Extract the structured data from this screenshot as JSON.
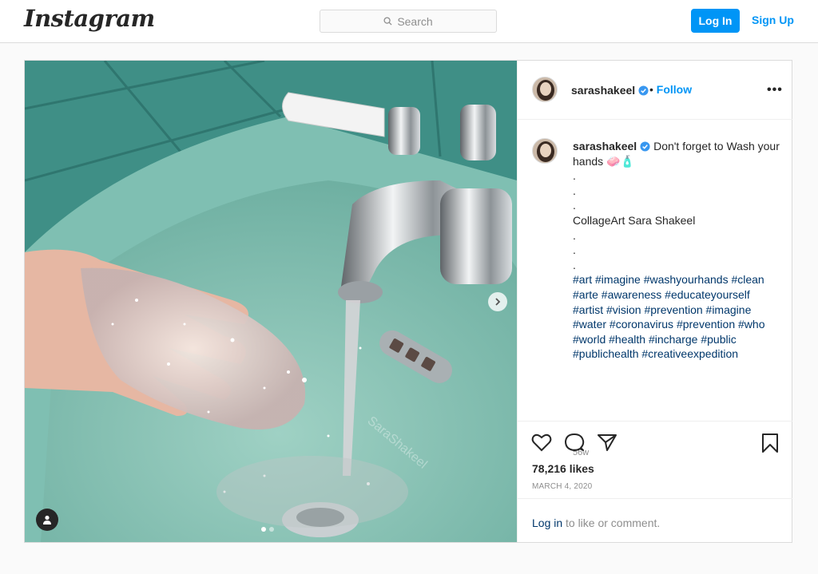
{
  "header": {
    "logo": "Instagram",
    "search_placeholder": "Search",
    "login_label": "Log In",
    "signup_label": "Sign Up"
  },
  "photo": {
    "watermark": "SaraShakeel",
    "carousel_dots": 2,
    "active_dot": 1
  },
  "post": {
    "username": "sarashakeel",
    "follow_label": "Follow",
    "follow_sep": "•",
    "more_label": "•••",
    "caption_first": "Don't forget to Wash your hands 🧼🧴",
    "caption_lines": [
      ".",
      ".",
      ".",
      "CollageArt Sara Shakeel",
      ".",
      ".",
      "."
    ],
    "hashtags": "#art #imagine #washyourhands #clean #arte #awareness #educateyourself #artist #vision #prevention #imagine #water #coronavirus #prevention #who #world #health #incharge #public #publichealth #creativeexpedition",
    "time_ago": "56w",
    "likes": "78,216 likes",
    "date": "MARCH 4, 2020",
    "login_link": "Log in",
    "login_rest": "to like or comment."
  },
  "icons": [
    "search-icon",
    "verified-icon",
    "heart-icon",
    "comment-icon",
    "share-icon",
    "bookmark-icon",
    "chevron-right-icon",
    "user-tag-icon"
  ],
  "colors": {
    "accent": "#0095f6",
    "link": "#00376b",
    "muted": "#8e8e8e",
    "border": "#dbdbdb"
  }
}
